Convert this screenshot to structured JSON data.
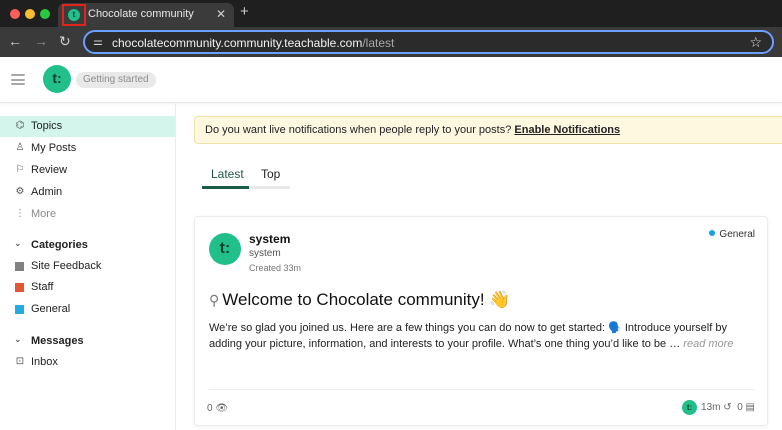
{
  "browser": {
    "tab_title": "Chocolate community",
    "tab_favicon_letter": "t",
    "url_host": "chocolatecommunity.community.teachable.com",
    "url_path": "/latest"
  },
  "header": {
    "logo_text": "t:",
    "getting_started": "Getting started"
  },
  "sidebar": {
    "nav": [
      {
        "label": "Topics",
        "icon": "layers-icon",
        "glyph": "⌬"
      },
      {
        "label": "My Posts",
        "icon": "user-icon",
        "glyph": "♙"
      },
      {
        "label": "Review",
        "icon": "flag-icon",
        "glyph": "⚐"
      },
      {
        "label": "Admin",
        "icon": "wrench-icon",
        "glyph": "⚙"
      },
      {
        "label": "More",
        "icon": "more-vertical-icon",
        "glyph": "⋮"
      }
    ],
    "categories_heading": "Categories",
    "categories": [
      {
        "label": "Site Feedback",
        "color": "#808080"
      },
      {
        "label": "Staff",
        "color": "#e45735"
      },
      {
        "label": "General",
        "color": "#25aae1"
      }
    ],
    "messages_heading": "Messages",
    "messages": [
      {
        "label": "Inbox",
        "icon": "inbox-icon",
        "glyph": "⊡"
      }
    ]
  },
  "notification": {
    "text": "Do you want live notifications when people reply to your posts?",
    "link": "Enable Notifications"
  },
  "tabs": {
    "latest": "Latest",
    "top": "Top"
  },
  "post": {
    "avatar_text": "t:",
    "author": "system",
    "handle": "system",
    "created": "Created 33m",
    "category": "General",
    "title": "Welcome to Chocolate community!",
    "title_emoji": "👋",
    "excerpt": "We’re so glad you joined us. Here are a few things you can do now to get started: 🗣️ Introduce yourself by adding your picture, information, and interests to your profile. What’s one thing you’d like to be …",
    "read_more": "read more",
    "views": "0",
    "activity_age": "13m",
    "replies": "0"
  },
  "colors": {
    "accent": "#21c08b",
    "active_bg": "#d3f5eb",
    "banner_bg": "#fef8e1"
  }
}
